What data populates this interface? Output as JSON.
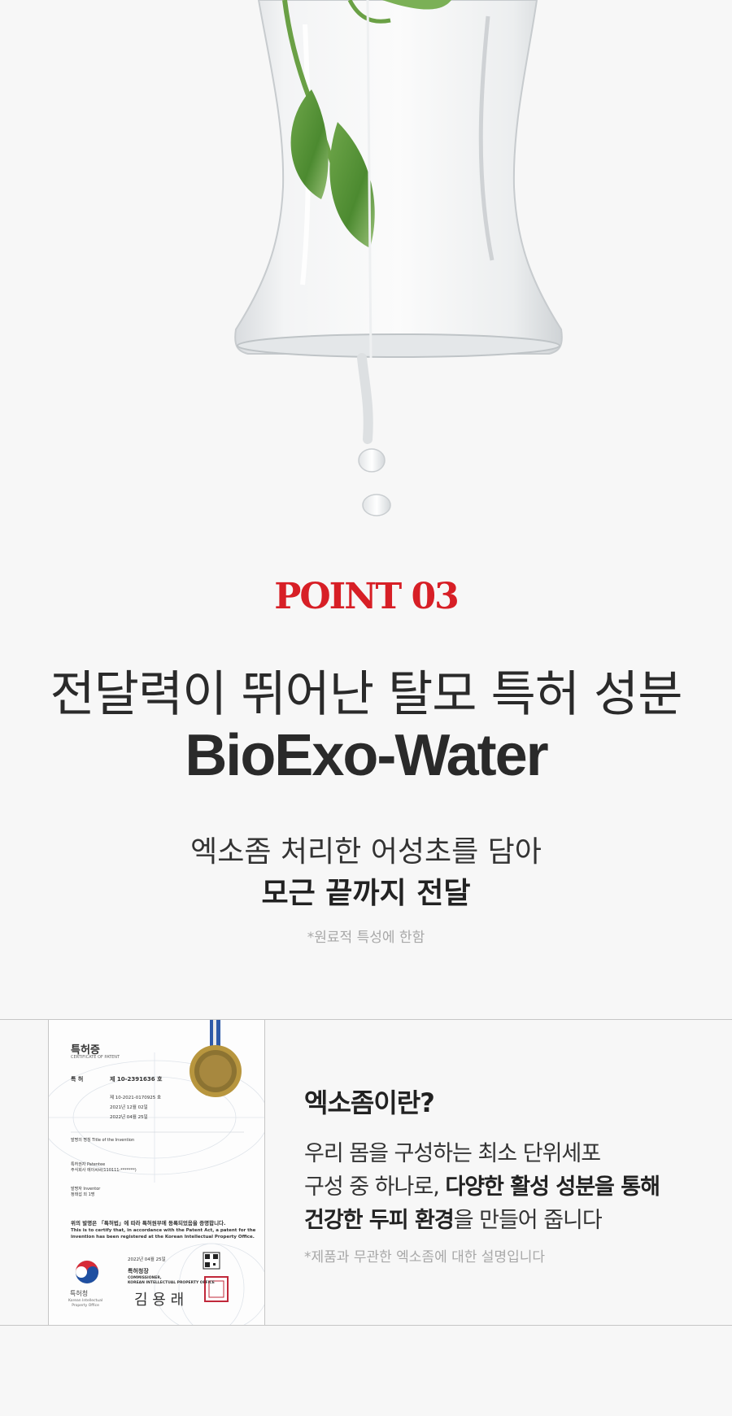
{
  "point_label": "POINT 03",
  "headline": "전달력이 뛰어난 탈모 특허 성분",
  "product_name": "BioExo-Water",
  "subtitle_line1": "엑소좀 처리한 어성초를 담아",
  "subtitle_line2": "모근 끝까지 전달",
  "footnote_ingredient": "*원료적 특성에 한함",
  "certificate": {
    "title": "특허증",
    "subtitle": "CERTIFICATE OF PATENT",
    "patent_label": "특 허",
    "patent_number": "제 10-2391636 호",
    "application_number": "제 10-2021-0170925 호",
    "filing_date": "2021년 12월 02일",
    "registration_date": "2022년 04월 25일",
    "invention_title": "발명의 명칭  Title of the Invention",
    "owner": "특허권자  Patentee",
    "owner_name": "주식회사 에이씨씨(110111-*******)",
    "inventor": "발명자  Inventor",
    "inventor_name": "정태섭 외 1명",
    "statement": "위의 발명은 「특허법」에 따라 특허원부에 등록되었음을 증명합니다.",
    "statement_en_1": "This is to certify that, in accordance with the Patent Act, a patent for the",
    "statement_en_2": "invention has been registered at the Korean Intellectual Property Office.",
    "issue_date": "2022년 04월 25일",
    "commissioner": "특허청장",
    "commissioner_en_1": "COMMISSIONER,",
    "commissioner_en_2": "KOREAN INTELLECTUAL PROPERTY OFFICE",
    "signature": "김 용 래",
    "office": "특허청",
    "office_en_1": "Korean Intellectual",
    "office_en_2": "Property Office"
  },
  "info_title": "엑소좀이란?",
  "info_line1": "우리 몸을 구성하는 최소 단위세포",
  "info_line2_a": "구성 중 하나로, ",
  "info_line2_b": "다양한 활성 성분을 통해",
  "info_line3_a": "건강한 두피 환경",
  "info_line3_b": "을 만들어 줍니다",
  "footnote_exosome": "*제품과 무관한 엑소좀에 대한 설명입니다",
  "colors": {
    "accent": "#d71f26",
    "text": "#2a2a2a",
    "muted": "#a8a8a8",
    "background": "#f7f7f7"
  }
}
